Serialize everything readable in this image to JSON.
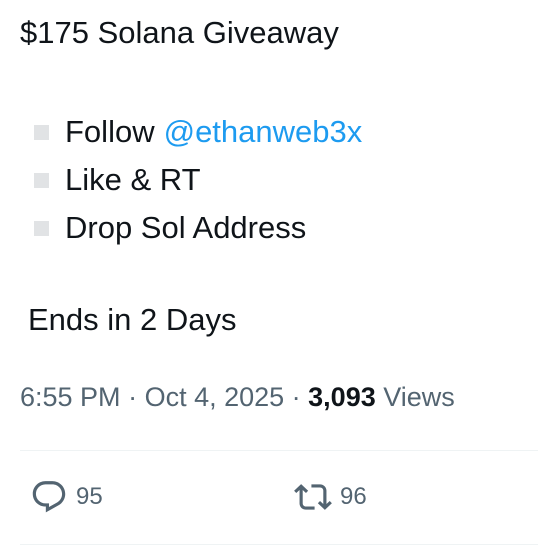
{
  "tweet": {
    "title": "$175 Solana Giveaway",
    "steps": [
      {
        "text": "Follow",
        "mention": "@ethanweb3x"
      },
      {
        "text": "Like & RT"
      },
      {
        "text": "Drop Sol Address"
      }
    ],
    "ends": "Ends in 2 Days",
    "meta": {
      "time": "6:55 PM",
      "separator": " · ",
      "date": "Oct 4, 2025",
      "views_count": "3,093",
      "views_label": " Views"
    },
    "actions": {
      "replies": "95",
      "retweets": "96"
    }
  },
  "icons": {
    "reply": "speech-bubble-icon",
    "retweet": "retweet-arrows-icon",
    "checkbox": "square-bullet-icon"
  },
  "colors": {
    "text": "#0f1419",
    "muted": "#536471",
    "link": "#1d9bf0",
    "bullet_box": "#e1e3e5",
    "divider": "#eff3f4"
  }
}
